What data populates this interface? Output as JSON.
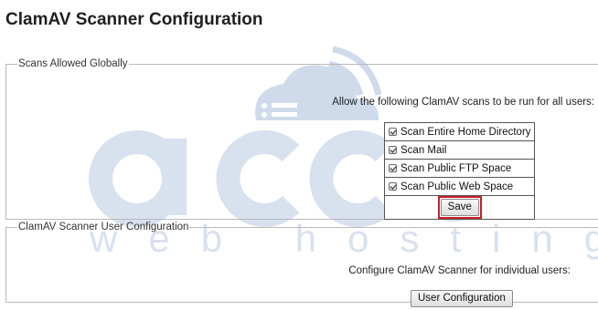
{
  "page": {
    "title": "ClamAV Scanner Configuration"
  },
  "scans_section": {
    "legend": "Scans Allowed Globally",
    "intro": "Allow the following ClamAV scans to be run for all users:",
    "options": [
      {
        "label": "Scan Entire Home Directory",
        "checked": true
      },
      {
        "label": "Scan Mail",
        "checked": true
      },
      {
        "label": "Scan Public FTP Space",
        "checked": true
      },
      {
        "label": "Scan Public Web Space",
        "checked": true
      }
    ],
    "save_label": "Save",
    "highlight_color": "#c8202a"
  },
  "user_section": {
    "legend": "ClamAV Scanner User Configuration",
    "intro": "Configure ClamAV Scanner for individual users:",
    "button_label": "User Configuration"
  },
  "watermark": {
    "brand": "accu",
    "tagline": "web hosting",
    "icon": "cloud-wifi-icon",
    "color": "#9fb6d6"
  }
}
